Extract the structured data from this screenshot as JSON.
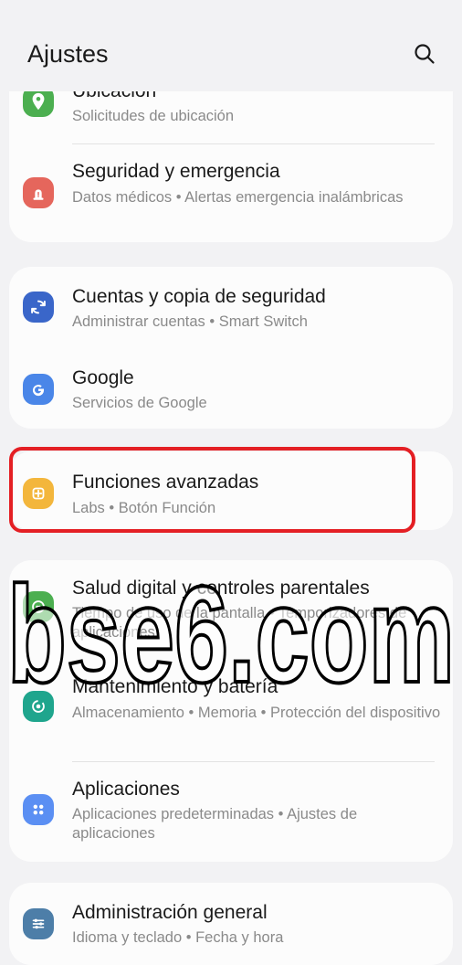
{
  "header": {
    "title": "Ajustes",
    "search_icon": "search-icon"
  },
  "items": [
    {
      "title": "Ubicación",
      "subtitle": "Solicitudes de ubicación",
      "icon": "location-pin-icon",
      "color": "#4caf50"
    },
    {
      "title": "Seguridad y emergencia",
      "subtitle": "Datos médicos  •  Alertas emergencia inalámbricas",
      "icon": "emergency-icon",
      "color": "#e5665c"
    },
    {
      "title": "Cuentas y copia de seguridad",
      "subtitle": "Administrar cuentas  •  Smart Switch",
      "icon": "sync-icon",
      "color": "#3a66c9"
    },
    {
      "title": "Google",
      "subtitle": "Servicios de Google",
      "icon": "google-g-icon",
      "color": "#4a86e8"
    },
    {
      "title": "Funciones avanzadas",
      "subtitle": "Labs  •  Botón Función",
      "icon": "advanced-features-icon",
      "color": "#f3b63c"
    },
    {
      "title": "Salud digital y controles parentales",
      "subtitle": "Tiempo de uso de la pantalla  •  Temporizadores de aplicaciones",
      "icon": "digital-wellbeing-icon",
      "color": "#4caf50"
    },
    {
      "title": "Mantenimiento y batería",
      "subtitle": "Almacenamiento  •  Memoria  •  Protección del dispositivo",
      "icon": "device-care-icon",
      "color": "#1fa58d"
    },
    {
      "title": "Aplicaciones",
      "subtitle": "Aplicaciones predeterminadas  •  Ajustes de aplicaciones",
      "icon": "apps-grid-icon",
      "color": "#5b8ff3"
    },
    {
      "title": "Administración general",
      "subtitle": "Idioma y teclado  •  Fecha y hora",
      "icon": "sliders-icon",
      "color": "#4d7ea8"
    }
  ],
  "watermark": "bse6.com",
  "highlight_color": "#e41f24"
}
